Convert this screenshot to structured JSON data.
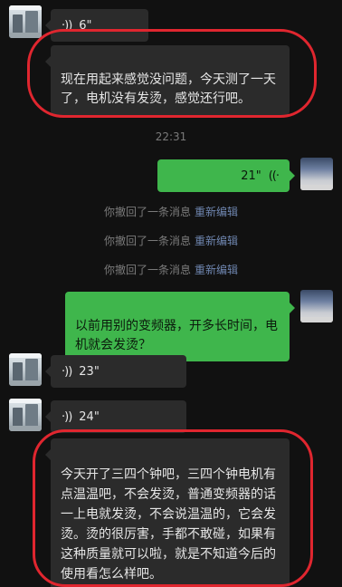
{
  "messages": {
    "m1_voice": {
      "duration": "6\""
    },
    "m2_text": {
      "text": "现在用起来感觉没问题，今天测了一天了，电机没有发烫，感觉还行吧。"
    },
    "timestamp": "22:31",
    "m3_voice_sent": {
      "duration": "21\""
    },
    "recalls": [
      {
        "text": "你撤回了一条消息",
        "action": "重新编辑"
      },
      {
        "text": "你撤回了一条消息",
        "action": "重新编辑"
      },
      {
        "text": "你撤回了一条消息",
        "action": "重新编辑"
      }
    ],
    "m4_text_sent": {
      "text": "以前用别的变频器，开多长时间，电机就会发烫？"
    },
    "m5_voice": {
      "duration": "23\""
    },
    "m6_voice": {
      "duration": "24\""
    },
    "m7_text": {
      "text": "今天开了三四个钟吧，三四个钟电机有点温温吧，不会发烫，普通变频器的话一上电就发烫，不会说温温的，它会发烫。烫的很厉害，手都不敢碰，如果有这种质量就可以啦，就是不知道今后的使用看怎么样吧。"
    }
  },
  "icons": {
    "voice_recv": "voice-wave-icon",
    "voice_sent": "voice-wave-icon"
  },
  "colors": {
    "background": "#111111",
    "received_bubble": "#2b2b2b",
    "sent_bubble": "#3fb64c",
    "annotation": "#e0262f",
    "reedit_link": "#6f86b0"
  }
}
